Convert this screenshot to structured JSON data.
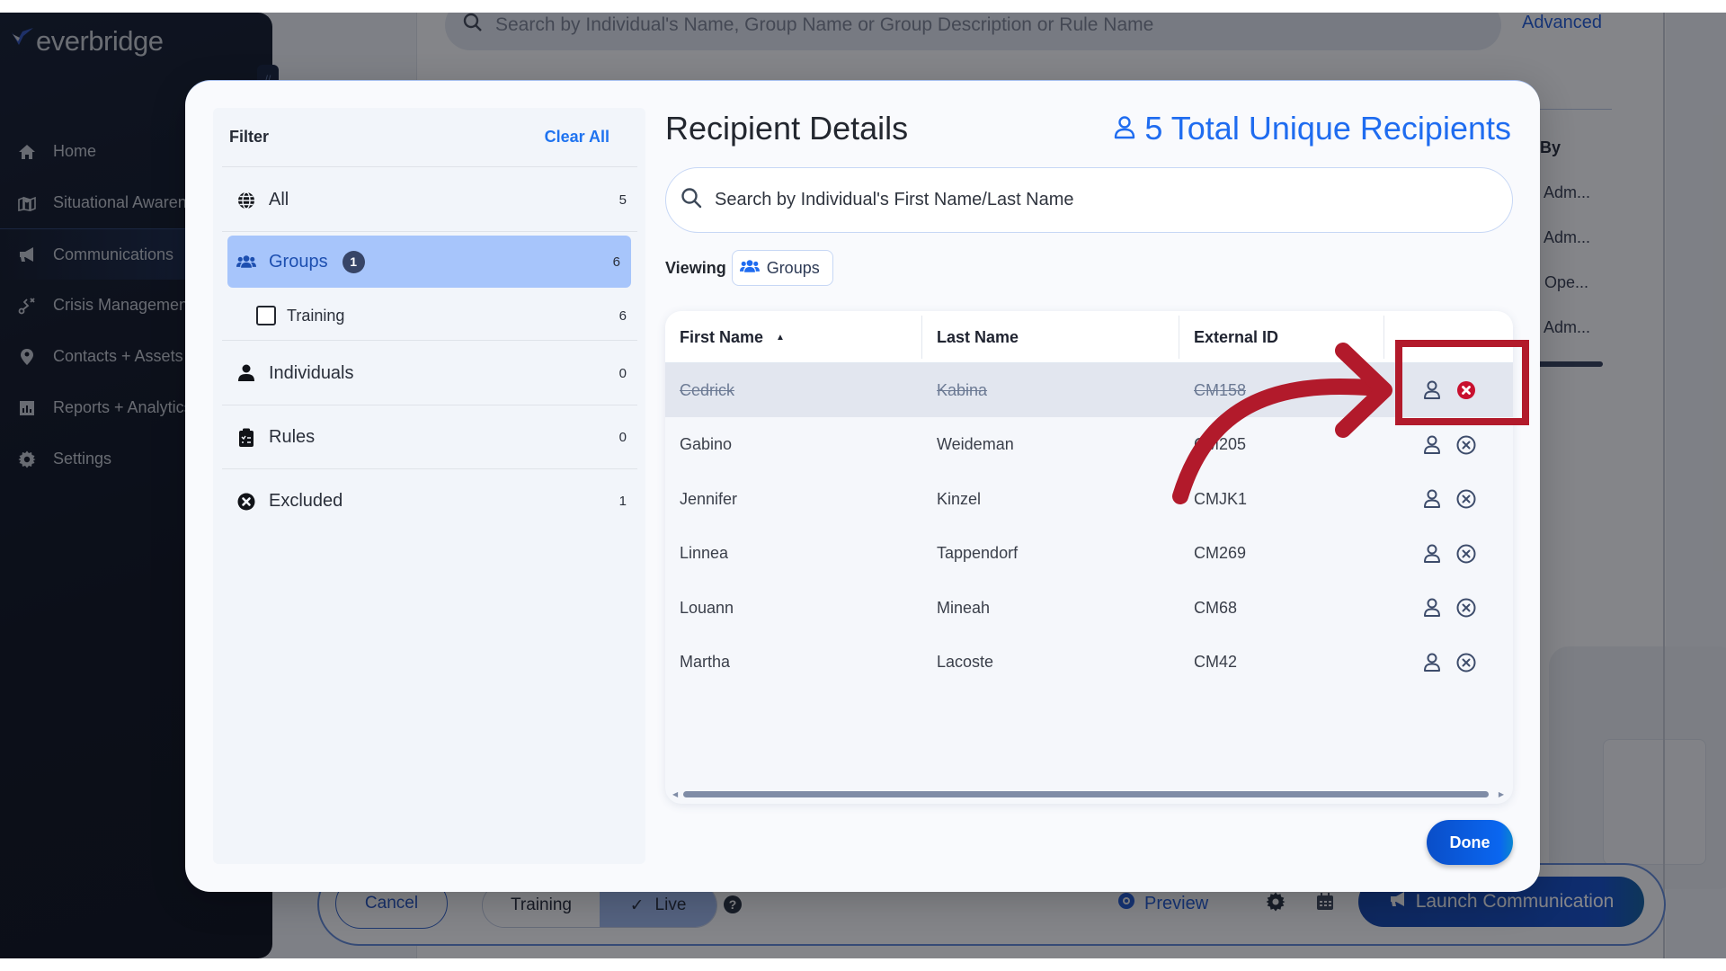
{
  "background": {
    "logo_text": "everbridge",
    "sidebar": {
      "items": [
        {
          "label": "Home",
          "icon": "home-icon"
        },
        {
          "label": "Situational Awareness",
          "icon": "map-icon"
        },
        {
          "label": "Communications",
          "icon": "megaphone-icon",
          "active": true
        },
        {
          "label": "Crisis Management",
          "icon": "route-icon"
        },
        {
          "label": "Contacts + Assets",
          "icon": "location-pin-icon"
        },
        {
          "label": "Reports + Analytics",
          "icon": "chart-icon"
        },
        {
          "label": "Settings",
          "icon": "gear-icon"
        }
      ]
    },
    "search_placeholder": "Search by Individual's Name, Group Name or Group Description or Rule Name",
    "advanced_label": "Advanced",
    "column_by": "By",
    "column_by_cells": [
      "ge Adm...",
      "ge Adm...",
      "ge Ope...",
      "ge Adm..."
    ],
    "footer": {
      "cancel_label": "Cancel",
      "mode_training": "Training",
      "mode_live": "Live",
      "mode_selected": "Live",
      "preview_label": "Preview",
      "launch_label": "Launch Communication"
    }
  },
  "modal": {
    "filter": {
      "title": "Filter",
      "clear_all": "Clear All",
      "items": [
        {
          "label": "All",
          "count": "5",
          "icon": "globe-icon"
        },
        {
          "label": "Groups",
          "count": "6",
          "icon": "users-icon",
          "badge": "1",
          "selected": true
        },
        {
          "label": "Individuals",
          "count": "0",
          "icon": "user-icon"
        },
        {
          "label": "Rules",
          "count": "0",
          "icon": "clipboard-icon"
        },
        {
          "label": "Excluded",
          "count": "1",
          "icon": "x-circle-icon"
        }
      ],
      "group_children": [
        {
          "label": "Training",
          "count": "6",
          "checked": false
        }
      ]
    },
    "title": "Recipient Details",
    "total_recipients": "5 Total Unique Recipients",
    "search_placeholder": "Search by Individual's First Name/Last Name",
    "search_value": "",
    "viewing_label": "Viewing",
    "viewing_chip": "Groups",
    "table": {
      "columns": [
        "First Name",
        "Last Name",
        "External ID",
        ""
      ],
      "sort_column": "First Name",
      "sort_direction": "ascending",
      "rows": [
        {
          "first": "Cedrick",
          "last": "Kabina",
          "external_id": "CM158",
          "excluded": true
        },
        {
          "first": "Gabino",
          "last": "Weideman",
          "external_id": "CM205",
          "excluded": false
        },
        {
          "first": "Jennifer",
          "last": "Kinzel",
          "external_id": "CMJK1",
          "excluded": false
        },
        {
          "first": "Linnea",
          "last": "Tappendorf",
          "external_id": "CM269",
          "excluded": false
        },
        {
          "first": "Louann",
          "last": "Mineah",
          "external_id": "CM68",
          "excluded": false
        },
        {
          "first": "Martha",
          "last": "Lacoste",
          "external_id": "CM42",
          "excluded": false
        }
      ]
    },
    "done_label": "Done"
  },
  "annotation": {
    "color": "#b21a2b",
    "target": "exclude-action-row-1"
  },
  "colors": {
    "accent": "#1f6cf0",
    "selected_filter_bg": "#a7c5fb",
    "excluded_icon": "#c8102e",
    "sidebar_bg": "#050a16"
  }
}
